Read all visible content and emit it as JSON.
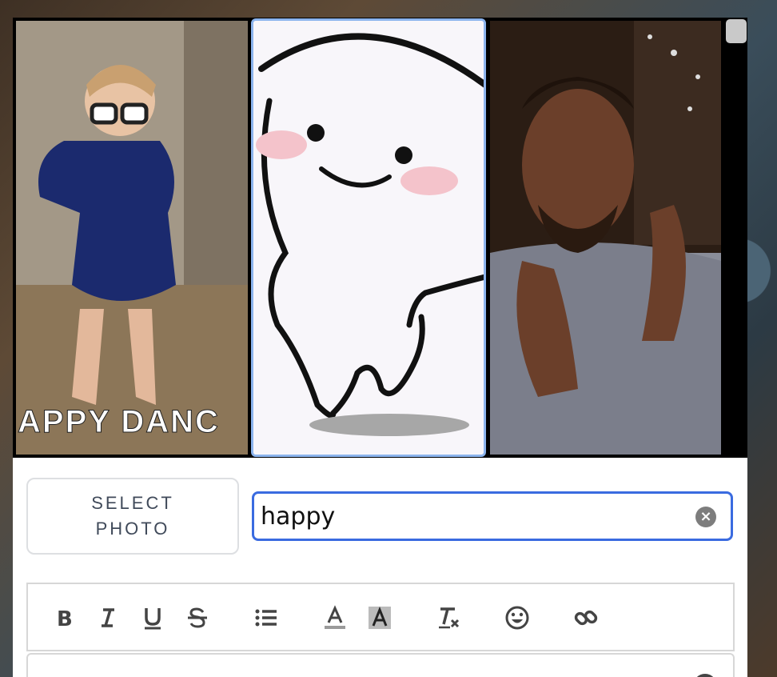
{
  "gifs": [
    {
      "name": "dancing-toddler-gif",
      "caption": "APPY DANC"
    },
    {
      "name": "cartoon-blob-dance-gif"
    },
    {
      "name": "clapping-man-gif"
    }
  ],
  "select_photo": {
    "label": "SELECT PHOTO"
  },
  "search": {
    "value": "happy",
    "clear_icon": "clear-icon"
  },
  "toolbar": {
    "buttons": [
      {
        "name": "bold-button",
        "icon": "bold-icon"
      },
      {
        "name": "italic-button",
        "icon": "italic-icon"
      },
      {
        "name": "underline-button",
        "icon": "underline-icon"
      },
      {
        "name": "strikethrough-button",
        "icon": "strikethrough-icon"
      },
      {
        "name": "bullet-list-button",
        "icon": "list-icon"
      },
      {
        "name": "text-color-button",
        "icon": "text-color-icon"
      },
      {
        "name": "highlight-button",
        "icon": "highlight-icon"
      },
      {
        "name": "clear-format-button",
        "icon": "clear-format-icon"
      },
      {
        "name": "emoji-button",
        "icon": "emoji-icon"
      },
      {
        "name": "link-button",
        "icon": "link-icon"
      }
    ]
  },
  "colors": {
    "accent": "#3a6be0",
    "selected_border": "#8cb4ee",
    "icon": "#444444"
  }
}
